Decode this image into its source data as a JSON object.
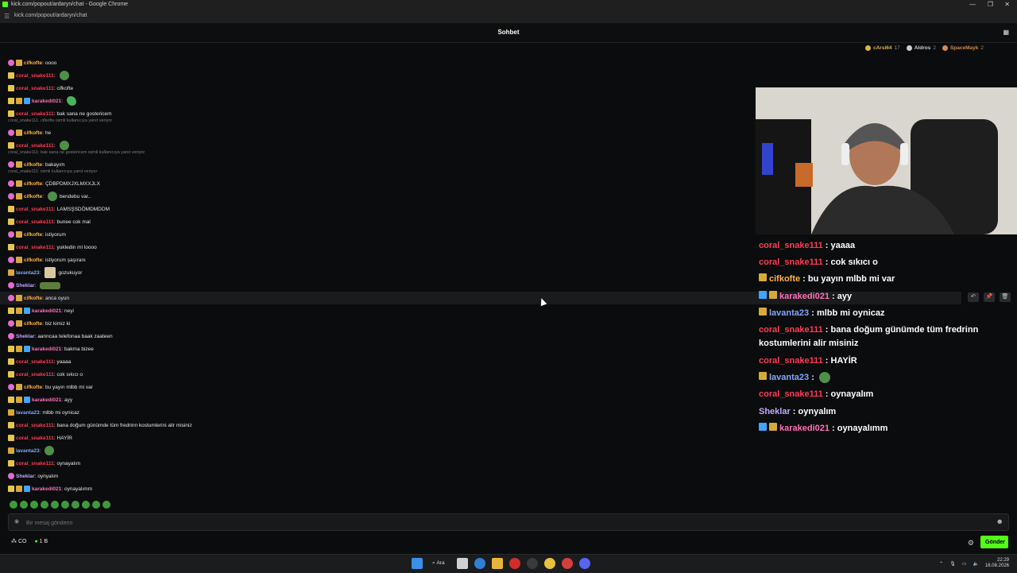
{
  "window": {
    "title": "kick.com/popout/ardaryn/chat - Google Chrome",
    "url": "kick.com/popout/ardaryn/chat"
  },
  "header": {
    "title": "Sohbet"
  },
  "leaderboard": [
    {
      "name": "cArsi64",
      "count": "17",
      "color": "#e0b341"
    },
    {
      "name": "Aldros",
      "count": "2",
      "color": "#cfcfcf"
    },
    {
      "name": "SpaceMayk",
      "count": "2",
      "color": "#d48b4c"
    }
  ],
  "colors": {
    "accent": "#53fc18",
    "coral": "#ff3b57",
    "cifkofte": "#ffb347",
    "karakedi": "#ff70b8",
    "lavanta": "#7fa7ff",
    "sheklar": "#c0a7ff"
  },
  "chat": {
    "replies": [
      "coral_snake111: cifkofte isimli kullanıcıya yanıt veriyor",
      "coral_snake111: bak sana ne gostericem isimli kullanıcıya yanıt veriyor",
      "coral_snake111: isimli kullanıcıya yanıt veriyor"
    ],
    "messages": [
      {
        "user": "cifkofte",
        "text": "oooo"
      },
      {
        "user": "coral_snake111",
        "text": ""
      },
      {
        "user": "coral_snake111",
        "text": "cifkofte"
      },
      {
        "user": "karakedi021",
        "text": ""
      },
      {
        "user": "coral_snake111",
        "text": "bak sana ne gostericem"
      },
      {
        "user": "cifkofte",
        "text": "he"
      },
      {
        "user": "coral_snake111",
        "text": ""
      },
      {
        "user": "cifkofte",
        "text": "bakayım"
      },
      {
        "user": "cifkofte",
        "text": "ÇDBPDMXJXLMXXJLX"
      },
      {
        "user": "cifkofte",
        "text": "bendebu var.."
      },
      {
        "user": "coral_snake111",
        "text": "LAMSŞSDÖMDMDDM"
      },
      {
        "user": "coral_snake111",
        "text": "bunee cok mal"
      },
      {
        "user": "cifkofte",
        "text": "istiyorum"
      },
      {
        "user": "coral_snake111",
        "text": "yukledin mi loooo"
      },
      {
        "user": "cifkofte",
        "text": "istiyorum şaşıranı"
      },
      {
        "user": "lavanta23",
        "text": "gozukuyor"
      },
      {
        "user": "Sheklar",
        "text": ""
      },
      {
        "user": "cifkofte",
        "text": "anca oyun"
      },
      {
        "user": "karakedi021",
        "text": "neyi"
      },
      {
        "user": "cifkofte",
        "text": "biz kimiz ki"
      },
      {
        "user": "Sheklar",
        "text": "aanncaa telefonaa baak zaateen"
      },
      {
        "user": "karakedi021",
        "text": "bakma bizee"
      },
      {
        "user": "coral_snake111",
        "text": "yaaaa"
      },
      {
        "user": "coral_snake111",
        "text": "cok sıkıcı o"
      },
      {
        "user": "cifkofte",
        "text": "bu yayın mlbb mi var"
      },
      {
        "user": "karakedi021",
        "text": "ayy"
      },
      {
        "user": "lavanta23",
        "text": "mlbb mi oynicaz"
      },
      {
        "user": "coral_snake111",
        "text": "bana doğum günümde tüm fredrinn kostumlerini alir misiniz"
      },
      {
        "user": "coral_snake111",
        "text": "HAYİR"
      },
      {
        "user": "lavanta23",
        "text": ""
      },
      {
        "user": "coral_snake111",
        "text": "oynayalım"
      },
      {
        "user": "Sheklar",
        "text": "oynyalım"
      },
      {
        "user": "karakedi021",
        "text": "oynayalımm"
      }
    ]
  },
  "overlay": {
    "messages": [
      {
        "user": "coral_snake111",
        "text": "yaaaa"
      },
      {
        "user": "coral_snake111",
        "text": "cok sıkıcı o"
      },
      {
        "user": "cifkofte",
        "text": "bu yayın mlbb mi var"
      },
      {
        "user": "karakedi021",
        "text": "ayy"
      },
      {
        "user": "lavanta23",
        "text": "mlbb mi oynicaz"
      },
      {
        "user": "coral_snake111",
        "text": "bana doğum günümde tüm fredrinn kostumlerini alir misiniz"
      },
      {
        "user": "coral_snake111",
        "text": "HAYİR"
      },
      {
        "user": "lavanta23",
        "text": ""
      },
      {
        "user": "coral_snake111",
        "text": "oynayalım"
      },
      {
        "user": "Sheklar",
        "text": "oynyalım"
      },
      {
        "user": "karakedi021",
        "text": "oynayalımm"
      }
    ]
  },
  "composer": {
    "placeholder": "Bir mesaj gönderin"
  },
  "bottom": {
    "left_label": "CO",
    "points": "1 B",
    "send_label": "Gönder"
  },
  "taskbar": {
    "search_label": "Ara",
    "time": "22:29",
    "date": "16.08.2026"
  }
}
